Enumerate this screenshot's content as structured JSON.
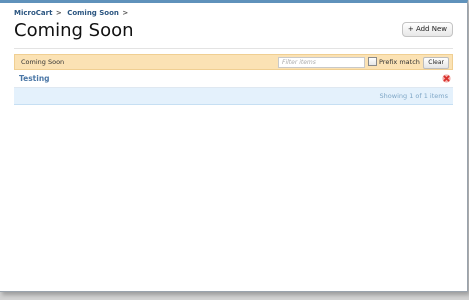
{
  "breadcrumb": {
    "items": [
      "MicroCart",
      "Coming Soon"
    ],
    "separator": ">"
  },
  "page": {
    "title": "Coming Soon"
  },
  "toolbar": {
    "add_new_label": "+ Add New"
  },
  "filter": {
    "list_label": "Coming Soon",
    "placeholder": "Filter items",
    "value": "",
    "prefix_match_label": "Prefix match",
    "prefix_match_checked": false,
    "clear_label": "Clear"
  },
  "list": {
    "items": [
      {
        "label": "Testing",
        "delete_icon": "delete-x-icon"
      }
    ],
    "footer_text": "Showing 1 of 1 items"
  },
  "colors": {
    "header_bar": "#fbe2b4",
    "footer_bar": "#e4f1fc",
    "link": "#4b77a6",
    "delete": "#d9302c",
    "window_border": "#5f92bb"
  }
}
